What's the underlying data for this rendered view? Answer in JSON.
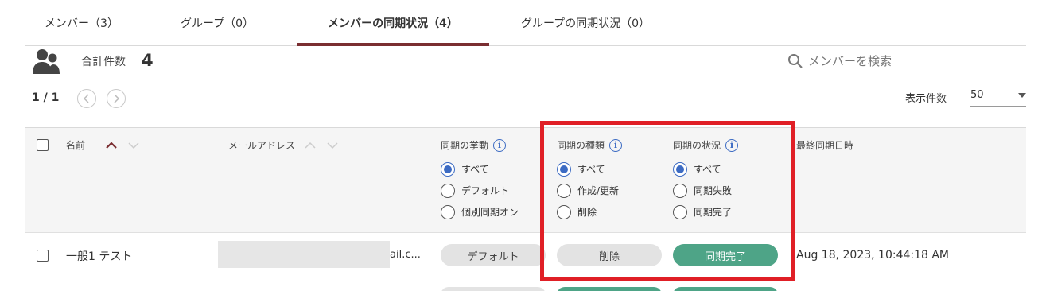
{
  "tabs": [
    {
      "label": "メンバー（3）",
      "active": false
    },
    {
      "label": "グループ（0）",
      "active": false
    },
    {
      "label": "メンバーの同期状況（4）",
      "active": true
    },
    {
      "label": "グループの同期状況（0）",
      "active": false
    }
  ],
  "summary": {
    "total_label": "合計件数",
    "total_count": "4",
    "pager": "1 / 1",
    "page_size_label": "表示件数",
    "page_size": "50"
  },
  "search": {
    "placeholder": "メンバーを検索"
  },
  "columns": {
    "name": "名前",
    "email": "メールアドレス",
    "sync_behavior": "同期の挙動",
    "sync_type": "同期の種類",
    "sync_status": "同期の状況",
    "last_sync": "最終同期日時"
  },
  "filters": {
    "sync_behavior": [
      "すべて",
      "デフォルト",
      "個別同期オン"
    ],
    "sync_type": [
      "すべて",
      "作成/更新",
      "削除"
    ],
    "sync_status": [
      "すべて",
      "同期失敗",
      "同期完了"
    ]
  },
  "rows": [
    {
      "name": "一般1 テスト",
      "email_tail": "ail.c...",
      "behavior": "デフォルト",
      "type": "削除",
      "status": "同期完了",
      "last_sync": "Aug 18, 2023, 10:44:18 AM"
    }
  ],
  "colors": {
    "accent_tab": "#7a2e31",
    "radio_selected": "#3c6bc3",
    "status_green": "#4ea487",
    "highlight_red": "#e01f26"
  }
}
